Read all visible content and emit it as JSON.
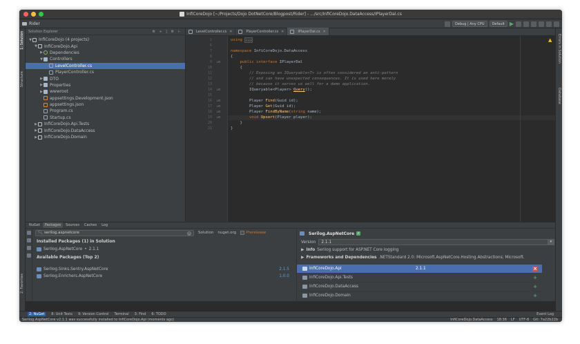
{
  "window": {
    "title": "InfiCoreDojo [~/Projects/Dojo DotNetCore/Blogpost/Rider] - .../src/InfiCoreDojo.DataAccess/IPlayerDal.cs",
    "traffic_colors": [
      "#fc605c",
      "#fdbc40",
      "#34c84a"
    ]
  },
  "toolbar": {
    "project": "Rider",
    "config": "Debug | Any CPU",
    "run_config": "Default"
  },
  "left_strip": {
    "solution": "1: Solution",
    "structure": "Structure",
    "favorites": "2: Favorites"
  },
  "right_strip": {
    "errors": "Errors in Solution",
    "database": "Database"
  },
  "explorer": {
    "title": "Solution Explorer",
    "tree": [
      {
        "label": "InfiCoreDojo (4 projects)",
        "icon": "solution-icon",
        "arrow": "▼"
      },
      {
        "label": "InfiCoreDojo.Api",
        "icon": "project-icon",
        "arrow": "▼"
      },
      {
        "label": "Dependencies",
        "icon": "dependencies-icon",
        "arrow": "▶"
      },
      {
        "label": "Controllers",
        "icon": "folder-icon",
        "arrow": "▼"
      },
      {
        "label": "LevelController.cs",
        "icon": "cs-file-icon",
        "arrow": ""
      },
      {
        "label": "PlayerController.cs",
        "icon": "cs-file-icon",
        "arrow": ""
      },
      {
        "label": "DTO",
        "icon": "folder-icon",
        "arrow": "▶"
      },
      {
        "label": "Properties",
        "icon": "folder-icon",
        "arrow": "▶"
      },
      {
        "label": "wwwroot",
        "icon": "folder-icon",
        "arrow": "▶"
      },
      {
        "label": "appsettings.Development.json",
        "icon": "json-file-icon",
        "arrow": ""
      },
      {
        "label": "appsettings.json",
        "icon": "json-file-icon",
        "arrow": ""
      },
      {
        "label": "Program.cs",
        "icon": "cs-file-icon",
        "arrow": ""
      },
      {
        "label": "Startup.cs",
        "icon": "cs-file-icon",
        "arrow": ""
      },
      {
        "label": "InfiCoreDojo.Api.Tests",
        "icon": "project-icon",
        "arrow": "▶"
      },
      {
        "label": "InfiCoreDojo.DataAccess",
        "icon": "project-icon",
        "arrow": "▶"
      },
      {
        "label": "InfiCoreDojo.Domain",
        "icon": "project-icon",
        "arrow": "▶"
      }
    ]
  },
  "editor": {
    "tabs": [
      {
        "label": "LevelController.cs"
      },
      {
        "label": "PlayerController.cs"
      },
      {
        "label": "IPlayerDal.cs"
      }
    ],
    "line_numbers": [
      "1",
      "6",
      "7",
      "8",
      "9",
      "10",
      "11",
      "12",
      "13",
      "14",
      "15",
      "16",
      "17",
      "18",
      "19",
      "20",
      "21"
    ],
    "code": {
      "l1_kw": "using",
      "l1_rest": "...",
      "l7_kw": "namespace",
      "l7_rest": "InfiCoreDojo.DataAccess",
      "l8": "{",
      "l9_kw": "public interface",
      "l9_rest": "IPlayerDal",
      "l10": "{",
      "l11": "// Exposing an IQueryable<T> is often considered an anti-pattern",
      "l12": "// and can have unexpected consequences. It is used here merely",
      "l13": "// because it serves us well for a demo application.",
      "l14_type": "IQueryable<Player>",
      "l14_fn": "Query",
      "l14_rest": "();",
      "l16_a": "Player",
      "l16_fn": "Find",
      "l16_b": "(Guid id);",
      "l17_a": "Player",
      "l17_fn": "Get",
      "l17_b": "(Guid id);",
      "l18_a": "Player",
      "l18_fn": "FindByName",
      "l18_kw": "string",
      "l18_b": "name);",
      "l19_kw": "void",
      "l19_fn": "Upsert",
      "l19_b": "(Player player);",
      "l20": "}",
      "l21": "}"
    }
  },
  "nuget": {
    "tabs": [
      "NuGet",
      "Packages",
      "Sources",
      "Caches",
      "Log"
    ],
    "search_value": "serilog.aspnetcore",
    "solution_label": "Solution",
    "source": "nuget.org",
    "prerelease": "Prerelease",
    "installed_header": "Installed Packages (1) in Solution",
    "installed": [
      {
        "name": "Serilog.AspNetCore",
        "version": "2.1.1"
      }
    ],
    "available_header": "Available Packages (Top 2)",
    "available": [
      {
        "name": "Serilog.Sinks.Sentry.AspNetCore",
        "version": "2.1.5"
      },
      {
        "name": "Serilog.Enrichers.AspNetCore",
        "version": "1.0.0"
      }
    ],
    "detail": {
      "package": "Serilog.AspNetCore",
      "version_label": "Version",
      "version": "2.1.1",
      "info_label": "Info",
      "info": "Serilog support for ASP.NET Core logging",
      "deps_label": "Frameworks and Dependencies",
      "deps": ".NETStandard 2.0: Microsoft.AspNetCore.Hosting.Abstractions; Microsoft.",
      "projects": [
        {
          "name": "InfiCoreDojo.Api",
          "version": "2.1.1",
          "action": "×"
        },
        {
          "name": "InfiCoreDojo.Api.Tests",
          "version": "",
          "action": "+"
        },
        {
          "name": "InfiCoreDojo.DataAccess",
          "version": "",
          "action": "+"
        },
        {
          "name": "InfiCoreDojo.Domain",
          "version": "",
          "action": "+"
        }
      ]
    }
  },
  "tool_windows": [
    {
      "label": "2: NuGet"
    },
    {
      "label": "8: Unit Tests"
    },
    {
      "label": "9: Version Control"
    },
    {
      "label": "Terminal"
    },
    {
      "label": "3: Find"
    },
    {
      "label": "6: TODO"
    }
  ],
  "event_log": "Event Log",
  "status": {
    "message": "Serilog.AspNetCore v2.1.1 was successfully installed to InfiCoreDojo.Api (moments ago)",
    "project": "InfiCoreDojo.DataAccess",
    "position": "18:36",
    "line_sep": "LF",
    "encoding": "UTF-8",
    "git": "Git: 7a22b22b"
  },
  "colors": {
    "accent": "#4b6eaf",
    "keyword": "#cc7832",
    "method": "#ffc66d",
    "comment": "#808080"
  }
}
